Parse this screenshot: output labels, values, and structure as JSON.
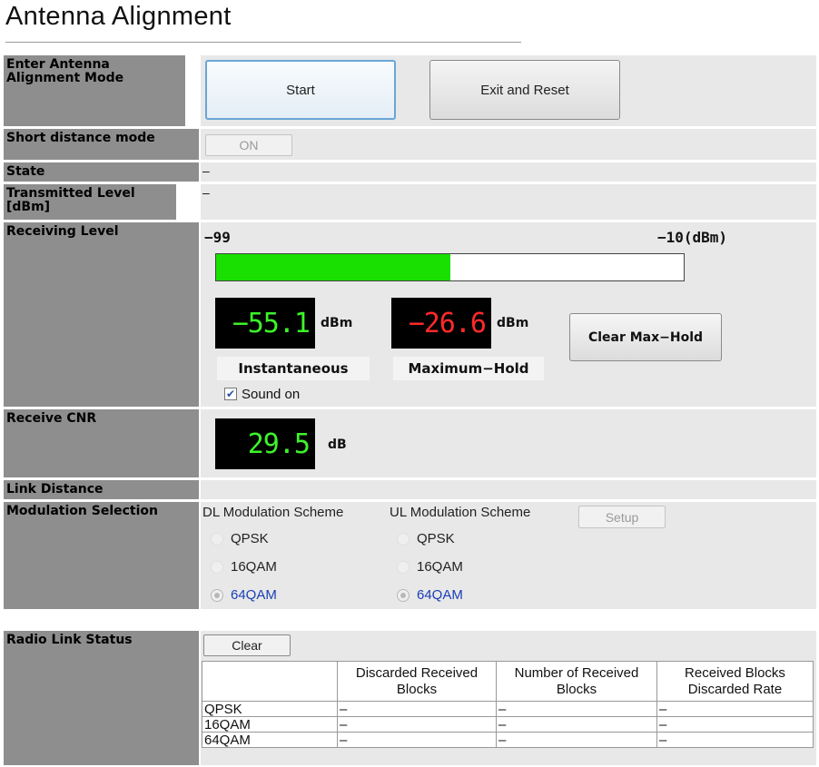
{
  "page": {
    "title": "Antenna Alignment"
  },
  "alignment_mode": {
    "label": "Enter Antenna Alignment Mode",
    "start_label": "Start",
    "exit_label": "Exit and Reset"
  },
  "short_distance": {
    "label": "Short distance mode",
    "button_label": "ON"
  },
  "state": {
    "label": "State",
    "value": "–"
  },
  "transmitted_level": {
    "label": "Transmitted Level [dBm]",
    "value": "–"
  },
  "receiving_level": {
    "label": "Receiving Level",
    "scale_min": "−99",
    "scale_max": "−10(dBm)",
    "bar_fill_fraction": 0.5,
    "bar_color": "#19e000",
    "instantaneous_value": "−55.1",
    "instantaneous_unit": "dBm",
    "instantaneous_caption": "Instantaneous",
    "max_hold_value": "−26.6",
    "max_hold_unit": "dBm",
    "max_hold_caption": "Maximum−Hold",
    "clear_max_hold_label": "Clear Max−Hold",
    "sound_label": "Sound on",
    "sound_checked": true,
    "value_color_green": "#3cf42a",
    "value_color_red": "#ff2a2a"
  },
  "receive_cnr": {
    "label": "Receive CNR",
    "value": "29.5",
    "unit": "dB"
  },
  "link_distance": {
    "label": "Link Distance"
  },
  "modulation": {
    "label": "Modulation Selection",
    "dl_heading": "DL Modulation Scheme",
    "ul_heading": "UL Modulation Scheme",
    "setup_label": "Setup",
    "options": [
      "QPSK",
      "16QAM",
      "64QAM"
    ],
    "dl_selected": "64QAM",
    "ul_selected": "64QAM"
  },
  "radio_link_status": {
    "label": "Radio Link Status",
    "clear_label": "Clear",
    "columns": [
      "",
      "Discarded Received Blocks",
      "Number of Received Blocks",
      "Received Blocks Discarded Rate"
    ],
    "rows": [
      {
        "name": "QPSK",
        "discarded": "–",
        "received": "–",
        "rate": "–"
      },
      {
        "name": "16QAM",
        "discarded": "–",
        "received": "–",
        "rate": "–"
      },
      {
        "name": "64QAM",
        "discarded": "–",
        "received": "–",
        "rate": "–"
      }
    ]
  }
}
